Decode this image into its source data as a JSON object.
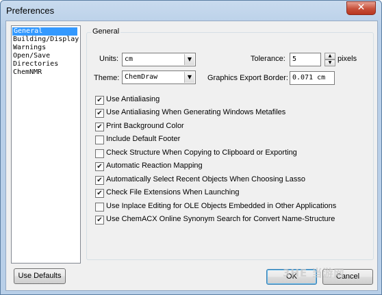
{
  "window": {
    "title": "Preferences",
    "close_glyph": "✕"
  },
  "sidebar": {
    "items": [
      {
        "label": "General",
        "selected": true
      },
      {
        "label": "Building/Display",
        "selected": false
      },
      {
        "label": "Warnings",
        "selected": false
      },
      {
        "label": "Open/Save",
        "selected": false
      },
      {
        "label": "Directories",
        "selected": false
      },
      {
        "label": "ChemNMR",
        "selected": false
      }
    ]
  },
  "general": {
    "group_title": "General",
    "units": {
      "label": "Units:",
      "value": "cm"
    },
    "theme": {
      "label": "Theme:",
      "value": "ChemDraw"
    },
    "tolerance": {
      "label": "Tolerance:",
      "value": "5",
      "unit": "pixels"
    },
    "export_border": {
      "label": "Graphics Export Border:",
      "value": "0.071 cm"
    },
    "options": [
      {
        "label": "Use Antialiasing",
        "checked": true
      },
      {
        "label": "Use Antialiasing When Generating Windows Metafiles",
        "checked": true
      },
      {
        "label": "Print Background Color",
        "checked": true
      },
      {
        "label": "Include Default Footer",
        "checked": false
      },
      {
        "label": "Check Structure When Copying to Clipboard or Exporting",
        "checked": false
      },
      {
        "label": "Automatic Reaction Mapping",
        "checked": true
      },
      {
        "label": "Automatically Select Recent Objects When Choosing Lasso",
        "checked": true
      },
      {
        "label": "Check File Extensions When Launching",
        "checked": true
      },
      {
        "label": "Use Inplace Editing for OLE Objects Embedded in Other Applications",
        "checked": false
      },
      {
        "label": "Use ChemACX Online Synonym Search for Convert Name-Structure",
        "checked": true
      }
    ]
  },
  "buttons": {
    "use_defaults": "Use Defaults",
    "ok": "OK",
    "cancel": "Cancel"
  },
  "icons": {
    "dropdown": "chevron-down-icon",
    "spin_up": "spin-up-icon",
    "spin_down": "spin-down-icon",
    "check": "checkmark-icon"
  },
  "watermark": {
    "text": "3HE 当游网"
  }
}
